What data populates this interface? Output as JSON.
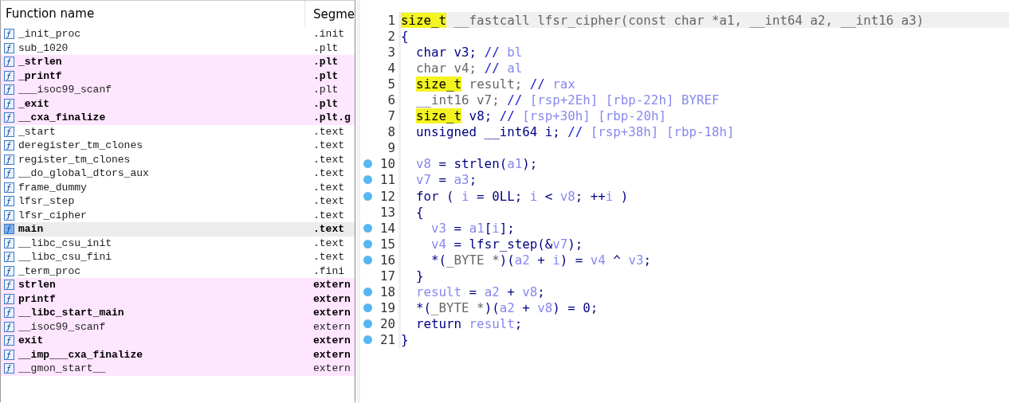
{
  "functions": {
    "columns": [
      "Function name",
      "Segme"
    ],
    "rows": [
      {
        "name": "_init_proc",
        "segment": ".init",
        "bold": false,
        "imported": false,
        "selected": false
      },
      {
        "name": "sub_1020",
        "segment": ".plt",
        "bold": false,
        "imported": false,
        "selected": false
      },
      {
        "name": "_strlen",
        "segment": ".plt",
        "bold": true,
        "imported": true,
        "selected": false
      },
      {
        "name": "_printf",
        "segment": ".plt",
        "bold": true,
        "imported": true,
        "selected": false
      },
      {
        "name": "___isoc99_scanf",
        "segment": ".plt",
        "bold": false,
        "imported": true,
        "selected": false
      },
      {
        "name": "_exit",
        "segment": ".plt",
        "bold": true,
        "imported": true,
        "selected": false
      },
      {
        "name": "__cxa_finalize",
        "segment": ".plt.g",
        "bold": true,
        "imported": true,
        "selected": false
      },
      {
        "name": "_start",
        "segment": ".text",
        "bold": false,
        "imported": false,
        "selected": false
      },
      {
        "name": "deregister_tm_clones",
        "segment": ".text",
        "bold": false,
        "imported": false,
        "selected": false
      },
      {
        "name": "register_tm_clones",
        "segment": ".text",
        "bold": false,
        "imported": false,
        "selected": false
      },
      {
        "name": "__do_global_dtors_aux",
        "segment": ".text",
        "bold": false,
        "imported": false,
        "selected": false
      },
      {
        "name": "frame_dummy",
        "segment": ".text",
        "bold": false,
        "imported": false,
        "selected": false
      },
      {
        "name": "lfsr_step",
        "segment": ".text",
        "bold": false,
        "imported": false,
        "selected": false
      },
      {
        "name": "lfsr_cipher",
        "segment": ".text",
        "bold": false,
        "imported": false,
        "selected": false
      },
      {
        "name": "main",
        "segment": ".text",
        "bold": true,
        "imported": false,
        "selected": true
      },
      {
        "name": "__libc_csu_init",
        "segment": ".text",
        "bold": false,
        "imported": false,
        "selected": false
      },
      {
        "name": "__libc_csu_fini",
        "segment": ".text",
        "bold": false,
        "imported": false,
        "selected": false
      },
      {
        "name": "_term_proc",
        "segment": ".fini",
        "bold": false,
        "imported": false,
        "selected": false
      },
      {
        "name": "strlen",
        "segment": "extern",
        "bold": true,
        "imported": true,
        "selected": false
      },
      {
        "name": "printf",
        "segment": "extern",
        "bold": true,
        "imported": true,
        "selected": false
      },
      {
        "name": "__libc_start_main",
        "segment": "extern",
        "bold": true,
        "imported": true,
        "selected": false
      },
      {
        "name": "__isoc99_scanf",
        "segment": "extern",
        "bold": false,
        "imported": true,
        "selected": false
      },
      {
        "name": "exit",
        "segment": "extern",
        "bold": true,
        "imported": true,
        "selected": false
      },
      {
        "name": "__imp___cxa_finalize",
        "segment": "extern",
        "bold": true,
        "imported": true,
        "selected": false
      },
      {
        "name": "__gmon_start__",
        "segment": "extern",
        "bold": false,
        "imported": true,
        "selected": false
      }
    ]
  },
  "pseudocode": {
    "lines": [
      {
        "number": "1",
        "marker": false,
        "current": true,
        "tokens": [
          {
            "kind": "type",
            "text": "size_t"
          },
          {
            "kind": "grey",
            "text": " __fastcall lfsr_cipher(const char *a1, __int64 a2, __int16 a3)"
          }
        ]
      },
      {
        "number": "2",
        "marker": false,
        "current": false,
        "tokens": [
          {
            "kind": "code",
            "text": "{"
          }
        ]
      },
      {
        "number": "3",
        "marker": false,
        "current": false,
        "tokens": [
          {
            "kind": "code",
            "text": "  char v3; "
          },
          {
            "kind": "comment",
            "text": "// "
          },
          {
            "kind": "var",
            "text": "bl"
          }
        ]
      },
      {
        "number": "4",
        "marker": false,
        "current": false,
        "tokens": [
          {
            "kind": "grey",
            "text": "  char v4; "
          },
          {
            "kind": "comment",
            "text": "// "
          },
          {
            "kind": "var",
            "text": "al"
          }
        ]
      },
      {
        "number": "5",
        "marker": false,
        "current": false,
        "tokens": [
          {
            "kind": "type",
            "text": "  size_t"
          },
          {
            "kind": "grey",
            "text": " result; "
          },
          {
            "kind": "comment",
            "text": "// "
          },
          {
            "kind": "var",
            "text": "rax"
          }
        ]
      },
      {
        "number": "6",
        "marker": false,
        "current": false,
        "tokens": [
          {
            "kind": "grey",
            "text": "  __int16 v7; "
          },
          {
            "kind": "comment",
            "text": "// "
          },
          {
            "kind": "var",
            "text": "[rsp+2Eh] [rbp-22h] BYREF"
          }
        ]
      },
      {
        "number": "7",
        "marker": false,
        "current": false,
        "tokens": [
          {
            "kind": "type",
            "text": "  size_t"
          },
          {
            "kind": "code",
            "text": " v8; "
          },
          {
            "kind": "comment",
            "text": "// "
          },
          {
            "kind": "var",
            "text": "[rsp+30h] [rbp-20h]"
          }
        ]
      },
      {
        "number": "8",
        "marker": false,
        "current": false,
        "tokens": [
          {
            "kind": "code",
            "text": "  unsigned __int64 i; "
          },
          {
            "kind": "comment",
            "text": "// "
          },
          {
            "kind": "var",
            "text": "[rsp+38h] [rbp-18h]"
          }
        ]
      },
      {
        "number": "9",
        "marker": false,
        "current": false
      },
      {
        "number": "10",
        "marker": true,
        "current": false,
        "tokens": [
          {
            "kind": "var",
            "text": "  v8"
          },
          {
            "kind": "code",
            "text": " = strlen("
          },
          {
            "kind": "var",
            "text": "a1"
          },
          {
            "kind": "code",
            "text": ");"
          }
        ]
      },
      {
        "number": "11",
        "marker": true,
        "current": false,
        "tokens": [
          {
            "kind": "var",
            "text": "  v7"
          },
          {
            "kind": "code",
            "text": " = "
          },
          {
            "kind": "var",
            "text": "a3"
          },
          {
            "kind": "code",
            "text": ";"
          }
        ]
      },
      {
        "number": "12",
        "marker": true,
        "current": false,
        "tokens": [
          {
            "kind": "code",
            "text": "  for ( "
          },
          {
            "kind": "var",
            "text": "i"
          },
          {
            "kind": "code",
            "text": " = 0LL; "
          },
          {
            "kind": "var",
            "text": "i"
          },
          {
            "kind": "code",
            "text": " < "
          },
          {
            "kind": "var",
            "text": "v8"
          },
          {
            "kind": "code",
            "text": "; ++"
          },
          {
            "kind": "var",
            "text": "i"
          },
          {
            "kind": "code",
            "text": " )"
          }
        ]
      },
      {
        "number": "13",
        "marker": false,
        "current": false,
        "tokens": [
          {
            "kind": "code",
            "text": "  {"
          }
        ]
      },
      {
        "number": "14",
        "marker": true,
        "current": false,
        "tokens": [
          {
            "kind": "var",
            "text": "    v3"
          },
          {
            "kind": "code",
            "text": " = "
          },
          {
            "kind": "var",
            "text": "a1"
          },
          {
            "kind": "code",
            "text": "["
          },
          {
            "kind": "var",
            "text": "i"
          },
          {
            "kind": "code",
            "text": "];"
          }
        ]
      },
      {
        "number": "15",
        "marker": true,
        "current": false,
        "tokens": [
          {
            "kind": "var",
            "text": "    v4"
          },
          {
            "kind": "code",
            "text": " = lfsr_step(&"
          },
          {
            "kind": "var",
            "text": "v7"
          },
          {
            "kind": "code",
            "text": ");"
          }
        ]
      },
      {
        "number": "16",
        "marker": true,
        "current": false,
        "tokens": [
          {
            "kind": "code",
            "text": "    *("
          },
          {
            "kind": "grey",
            "text": "_BYTE *"
          },
          {
            "kind": "code",
            "text": ")("
          },
          {
            "kind": "var",
            "text": "a2"
          },
          {
            "kind": "code",
            "text": " + "
          },
          {
            "kind": "var",
            "text": "i"
          },
          {
            "kind": "code",
            "text": ") = "
          },
          {
            "kind": "var",
            "text": "v4"
          },
          {
            "kind": "code",
            "text": " ^ "
          },
          {
            "kind": "var",
            "text": "v3"
          },
          {
            "kind": "code",
            "text": ";"
          }
        ]
      },
      {
        "number": "17",
        "marker": false,
        "current": false,
        "tokens": [
          {
            "kind": "code",
            "text": "  }"
          }
        ]
      },
      {
        "number": "18",
        "marker": true,
        "current": false,
        "tokens": [
          {
            "kind": "var",
            "text": "  result"
          },
          {
            "kind": "code",
            "text": " = "
          },
          {
            "kind": "var",
            "text": "a2"
          },
          {
            "kind": "code",
            "text": " + "
          },
          {
            "kind": "var",
            "text": "v8"
          },
          {
            "kind": "code",
            "text": ";"
          }
        ]
      },
      {
        "number": "19",
        "marker": true,
        "current": false,
        "tokens": [
          {
            "kind": "code",
            "text": "  *("
          },
          {
            "kind": "grey",
            "text": "_BYTE *"
          },
          {
            "kind": "code",
            "text": ")("
          },
          {
            "kind": "var",
            "text": "a2"
          },
          {
            "kind": "code",
            "text": " + "
          },
          {
            "kind": "var",
            "text": "v8"
          },
          {
            "kind": "code",
            "text": ") = 0;"
          }
        ]
      },
      {
        "number": "20",
        "marker": true,
        "current": false,
        "tokens": [
          {
            "kind": "code",
            "text": "  return "
          },
          {
            "kind": "var",
            "text": "result"
          },
          {
            "kind": "code",
            "text": ";"
          }
        ]
      },
      {
        "number": "21",
        "marker": true,
        "current": false,
        "tokens": [
          {
            "kind": "code",
            "text": "}"
          }
        ]
      }
    ]
  }
}
